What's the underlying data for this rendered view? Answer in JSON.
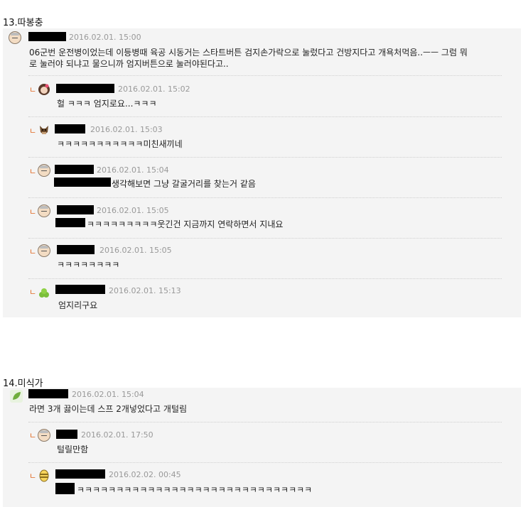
{
  "sections": [
    {
      "title": "13.따봉충",
      "post": {
        "date": "2016.02.01. 15:00",
        "text_line1": "06군번 운전병이었는데 이등병때 육공 시동거는 스타트버튼 검지손가락으로 눌렀다고 건방지다고 개욕처먹음..ㅡㅡ 그럼 뭐",
        "text_line2": "로 눌러야 되냐고 물으니까 엄지버튼으로 눌러야된다고.."
      },
      "replies": [
        {
          "date": "2016.02.01. 15:02",
          "text": "헐 ㅋㅋㅋ 엄지로요...ㅋㅋㅋ"
        },
        {
          "date": "2016.02.01. 15:03",
          "text": "ㅋㅋㅋㅋㅋㅋㅋㅋㅋㅋㅋ미친새끼네"
        },
        {
          "date": "2016.02.01. 15:04",
          "text": "생각해보면 그냥 갈굴거리를 찾는거 같음"
        },
        {
          "date": "2016.02.01. 15:05",
          "text": "ㅋㅋㅋㅋㅋㅋㅋㅋㅋ웃긴건 지금까지 연락하면서 지내요"
        },
        {
          "date": "2016.02.01. 15:05",
          "text": "ㅋㅋㅋㅋㅋㅋㅋㅋ"
        },
        {
          "date": "2016.02.01. 15:13",
          "text": "엄지리구요"
        }
      ]
    },
    {
      "title": "14.미식가",
      "post": {
        "date": "2016.02.01. 15:04",
        "text_line1": "라면 3개 끓이는데 스프 2개넣었다고 개털림"
      },
      "replies": [
        {
          "date": "2016.02.01. 17:50",
          "text": "털릴만함"
        },
        {
          "date": "2016.02.02. 00:45",
          "text": "ㅋㅋㅋㅋㅋㅋㅋㅋㅋㅋㅋㅋㅋㅋㅋㅋㅋㅋㅋㅋㅋㅋㅋㅋㅋㅋㅋㅋㅋㅋ"
        }
      ]
    }
  ],
  "icons": {
    "reply_arrow": "ㄴ",
    "avatar_names": [
      "elder-face-icon",
      "girl-avatar-icon",
      "dog-avatar-icon",
      "elder-face-icon",
      "elder-face-icon",
      "elder-face-icon",
      "clover-icon",
      "leaf-icon",
      "elder-face-icon",
      "bee-icon"
    ]
  },
  "colors": {
    "panel_bg": "#f4f4f4",
    "date_text": "#999999",
    "reply_arrow": "#e0661f",
    "redaction": "#000000"
  }
}
